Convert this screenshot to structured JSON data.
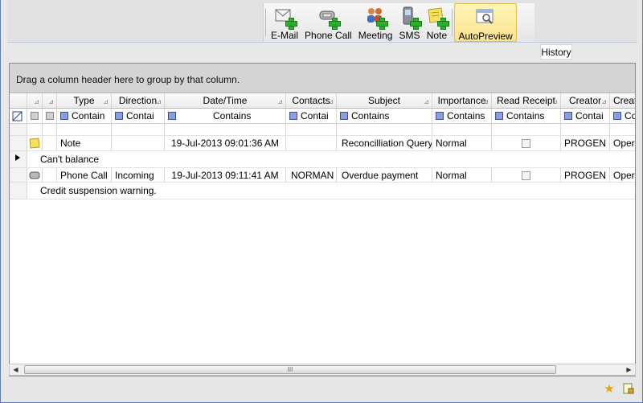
{
  "toolbar": {
    "email_label": "E-Mail",
    "phone_call_label": "Phone Call",
    "meeting_label": "Meeting",
    "sms_label": "SMS",
    "note_label": "Note",
    "autopreview_label": "AutoPreview"
  },
  "history_tab": "History",
  "grid": {
    "group_hint": "Drag a column header here to group by that column.",
    "headers": [
      "Type",
      "Direction",
      "Date/Time",
      "Contacts",
      "Subject",
      "Importance",
      "Read Receipt",
      "Creator",
      "Creat"
    ],
    "filters": [
      "Contain",
      "Contai",
      "Contains",
      "Contai",
      "Contains",
      "Contains",
      "Contains",
      "Contai",
      "Co"
    ],
    "rows": [
      {
        "type": "Note",
        "direction": "",
        "datetime": "19-Jul-2013 09:01:36 AM",
        "contacts": "",
        "subject": "Reconcilliation Query",
        "importance": "Normal",
        "creator": "PROGEN",
        "created": "Opera",
        "preview": "Can't balance"
      },
      {
        "type": "Phone Call",
        "direction": "Incoming",
        "datetime": "19-Jul-2013 09:11:41 AM",
        "contacts": "NORMAN",
        "subject": "Overdue payment",
        "importance": "Normal",
        "creator": "PROGEN",
        "created": "Opera",
        "preview": "Credit suspension warning."
      }
    ]
  },
  "scroll": {
    "thumb_grip": "III"
  },
  "icons": {
    "email": "email-add-icon",
    "phone": "phone-add-icon",
    "meeting": "meeting-add-icon",
    "sms": "sms-add-icon",
    "note": "note-add-icon",
    "autopreview": "autopreview-icon",
    "favorite": "star-icon",
    "lock": "lock-icon"
  }
}
